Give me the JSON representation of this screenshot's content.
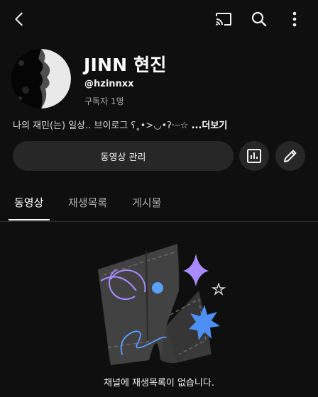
{
  "channel": {
    "name": "JINN 현진",
    "handle": "@hzinnxx",
    "subscribers": "구독자 1명",
    "description": "나의 재민(는) 일상.. 브이로그 ʕ˳•>◡•ʔ·┈☆ ",
    "more_label": "...더보기"
  },
  "actions": {
    "manage_label": "동영상 관리"
  },
  "tabs": [
    {
      "label": "동영상",
      "active": true
    },
    {
      "label": "재생목록",
      "active": false
    },
    {
      "label": "게시물",
      "active": false
    }
  ],
  "empty_state": {
    "message": "채널에 재생목록이 없습니다."
  },
  "icons": {
    "back": "back-arrow-icon",
    "cast": "cast-icon",
    "search": "search-icon",
    "more": "more-vertical-icon",
    "stats": "analytics-icon",
    "edit": "pencil-icon"
  },
  "colors": {
    "background": "#0f0f0f",
    "button": "#272727",
    "accent_purple": "#a98bff",
    "accent_blue": "#5aa0ff"
  }
}
